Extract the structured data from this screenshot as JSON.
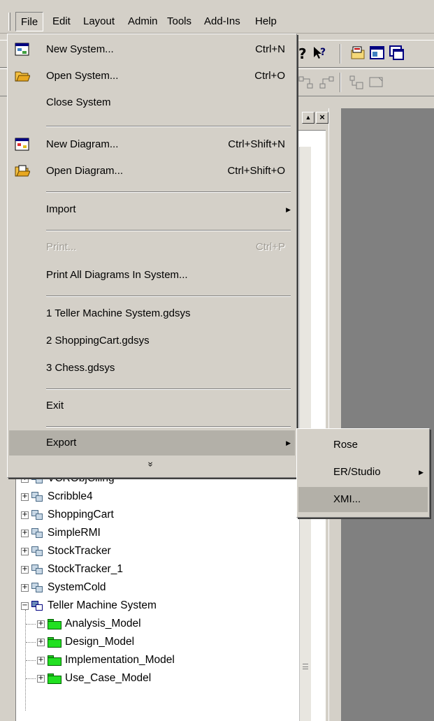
{
  "menubar": {
    "file": "File",
    "edit": "Edit",
    "layout": "Layout",
    "admin": "Admin",
    "tools": "Tools",
    "addins": "Add-Ins",
    "help": "Help"
  },
  "file_menu": {
    "new_system": {
      "label": "New System...",
      "shortcut": "Ctrl+N"
    },
    "open_system": {
      "label": "Open System...",
      "shortcut": "Ctrl+O"
    },
    "close_system": {
      "label": "Close System"
    },
    "new_diagram": {
      "label": "New Diagram...",
      "shortcut": "Ctrl+Shift+N"
    },
    "open_diagram": {
      "label": "Open Diagram...",
      "shortcut": "Ctrl+Shift+O"
    },
    "import": {
      "label": "Import"
    },
    "print": {
      "label": "Print...",
      "shortcut": "Ctrl+P"
    },
    "print_all": {
      "label": "Print All Diagrams In System..."
    },
    "recent_1": {
      "label": "1 Teller Machine System.gdsys"
    },
    "recent_2": {
      "label": "2 ShoppingCart.gdsys"
    },
    "recent_3": {
      "label": "3 Chess.gdsys"
    },
    "exit": {
      "label": "Exit"
    },
    "export": {
      "label": "Export"
    },
    "more_chevron": "»"
  },
  "export_menu": {
    "rose": "Rose",
    "erstudio": "ER/Studio",
    "xmi": "XMI..."
  },
  "tree": {
    "partial_item": "VCRObjCiling",
    "systems": [
      "Scribble4",
      "ShoppingCart",
      "SimpleRMI",
      "StockTracker",
      "StockTracker_1",
      "SystemCold",
      "Teller Machine System"
    ],
    "teller_children": [
      "Analysis_Model",
      "Design_Model",
      "Implementation_Model",
      "Use_Case_Model"
    ]
  }
}
